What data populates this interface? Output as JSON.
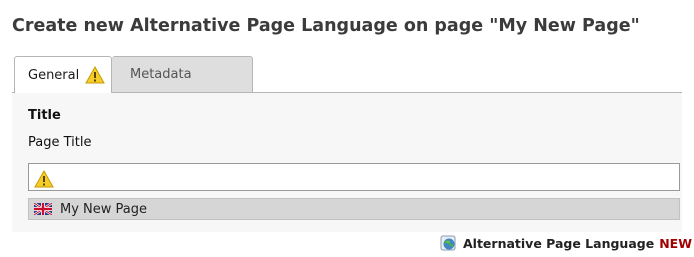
{
  "heading": "Create new Alternative Page Language on page \"My New Page\"",
  "tabs": [
    {
      "label": "General",
      "active": true,
      "icon": "warning-icon"
    },
    {
      "label": "Metadata",
      "active": false
    }
  ],
  "section": {
    "title": "Title",
    "field_label": "Page Title",
    "field_value": "",
    "field_icon": "warning-icon"
  },
  "language_bar": {
    "flag": "uk-flag-icon",
    "text": "My New Page"
  },
  "footer": {
    "icon": "globe-icon",
    "label": "Alternative Page Language",
    "badge": "NEW"
  },
  "colors": {
    "warning": "#f2c200",
    "new_badge": "#a00000",
    "tab_inactive": "#dedede"
  }
}
